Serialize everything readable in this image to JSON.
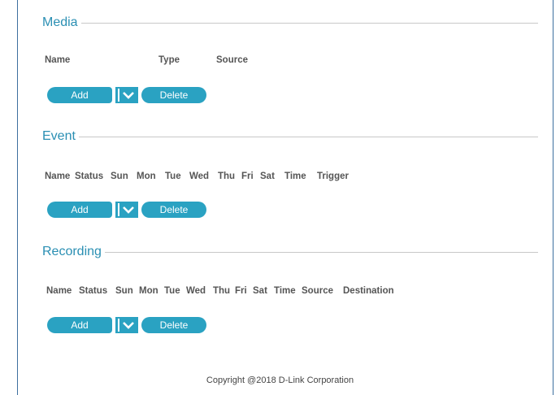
{
  "sections": {
    "media": {
      "title": "Media",
      "columns": [
        "Name",
        "Type",
        "Source"
      ],
      "add_label": "Add",
      "delete_label": "Delete"
    },
    "event": {
      "title": "Event",
      "columns": [
        "Name",
        "Status",
        "Sun",
        "Mon",
        "Tue",
        "Wed",
        "Thu",
        "Fri",
        "Sat",
        "Time",
        "Trigger"
      ],
      "add_label": "Add",
      "delete_label": "Delete"
    },
    "recording": {
      "title": "Recording",
      "columns": [
        "Name",
        "Status",
        "Sun",
        "Mon",
        "Tue",
        "Wed",
        "Thu",
        "Fri",
        "Sat",
        "Time",
        "Source",
        "Destination"
      ],
      "add_label": "Add",
      "delete_label": "Delete"
    }
  },
  "icons": {
    "dropdown": "chevron-down-icon"
  },
  "colors": {
    "accent": "#2aa2c2",
    "title": "#2a8fb3",
    "border": "#3d6f9e"
  },
  "footer": {
    "copyright": "Copyright @2018 D-Link Corporation"
  }
}
